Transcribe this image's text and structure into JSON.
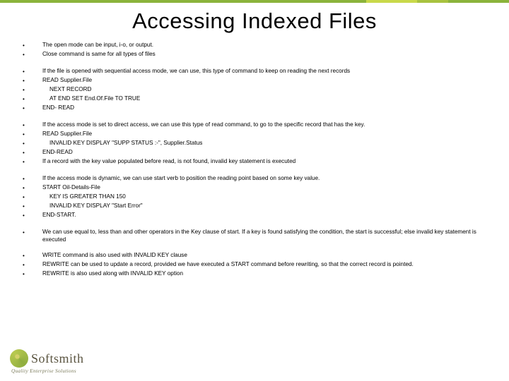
{
  "title": "Accessing Indexed Files",
  "groups": [
    [
      {
        "text": "The open mode can be input, i-o, or output.",
        "indent": 0
      },
      {
        "text": "Close command is same for all types of files",
        "indent": 0
      }
    ],
    [
      {
        "text": "If the file is opened with sequential access mode, we can use, this type of command to keep on reading the next records",
        "indent": 0
      },
      {
        "text": "READ Supplier.File",
        "indent": 0
      },
      {
        "text": "NEXT RECORD",
        "indent": 1
      },
      {
        "text": "AT END SET End.Of.File TO TRUE",
        "indent": 1
      },
      {
        "text": "END- READ",
        "indent": 0
      }
    ],
    [
      {
        "text": "If the access mode is set to direct access, we can use this type of read command, to go to the specific record that has the key.",
        "indent": 0
      },
      {
        "text": "READ Supplier.File",
        "indent": 0
      },
      {
        "text": "INVALID KEY DISPLAY \"SUPP STATUS :-\", Supplier.Status",
        "indent": 1
      },
      {
        "text": "END-READ",
        "indent": 0
      },
      {
        "text": "If a record with the key value populated before read, is not found, invalid key statement is executed",
        "indent": 0
      }
    ],
    [
      {
        "text": "If the access mode is dynamic, we can use start verb to position the reading point based on some key value.",
        "indent": 0
      },
      {
        "text": "START Oil-Details-File",
        "indent": 0
      },
      {
        "text": "KEY IS GREATER THAN 150",
        "indent": 1
      },
      {
        "text": "INVALID KEY DISPLAY \"Start Error\"",
        "indent": 1
      },
      {
        "text": "END-START.",
        "indent": 0
      }
    ],
    [
      {
        "text": "We can use equal to, less than and other operators in the Key clause of start. If a key is found satisfying the condition, the start is successful; else invalid key statement is executed",
        "indent": 0
      }
    ],
    [
      {
        "text": "WRITE command is also used with INVALID KEY clause",
        "indent": 0
      },
      {
        "text": "REWRITE can be used to update a record, provided we have executed a START command before rewriting, so that the correct record is pointed.",
        "indent": 0
      },
      {
        "text": "REWRITE is also used along with INVALID KEY option",
        "indent": 0
      }
    ]
  ],
  "logo": {
    "name": "Softsmith",
    "tagline": "Quality Enterprise Solutions"
  }
}
